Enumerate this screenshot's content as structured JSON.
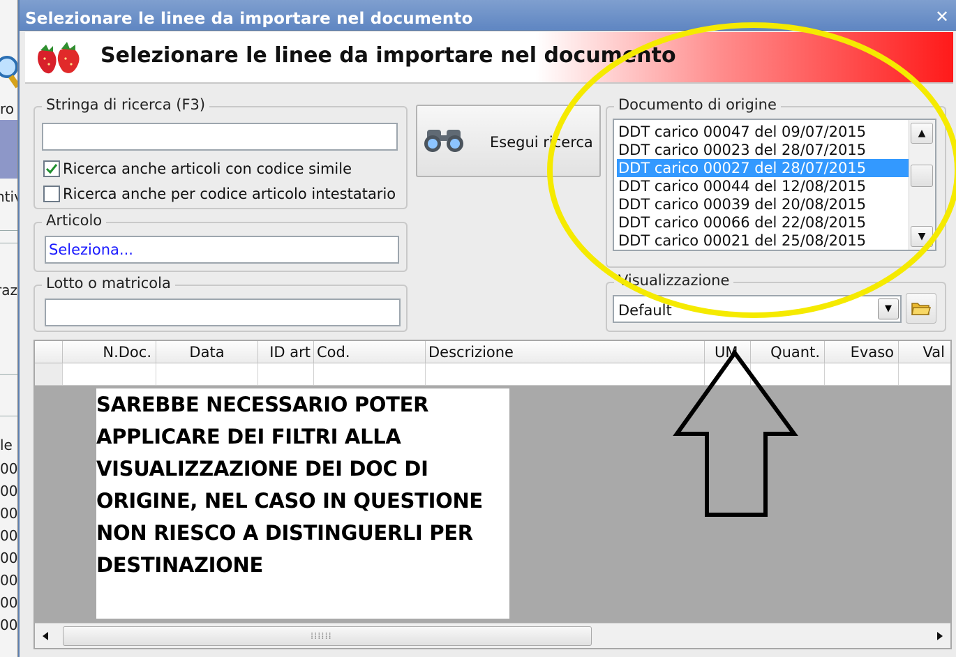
{
  "window": {
    "title": "Selezionare le linee da importare nel documento",
    "close_glyph": "✕"
  },
  "header": {
    "title": "Selezionare le linee da importare nel documento",
    "icon": "strawberry-logo-icon"
  },
  "background_app": {
    "fragments": [
      "ro",
      "ntiv",
      "raz",
      "le",
      "00",
      "00",
      "00",
      "00",
      "00",
      "00",
      "00",
      "00"
    ]
  },
  "search": {
    "group_label": "Stringa di ricerca (F3)",
    "value": "",
    "checkbox1": {
      "label": "Ricerca anche articoli con codice simile",
      "checked": true
    },
    "checkbox2": {
      "label": "Ricerca anche per codice articolo intestatario",
      "checked": false
    }
  },
  "articolo": {
    "group_label": "Articolo",
    "value": "Seleziona..."
  },
  "lotto": {
    "group_label": "Lotto o matricola",
    "value": ""
  },
  "search_button": {
    "label": "Esegui ricerca",
    "icon": "binoculars-icon"
  },
  "documento_origine": {
    "group_label": "Documento di origine",
    "items": [
      "DDT carico 00047 del 09/07/2015",
      "DDT carico 00023 del 28/07/2015",
      "DDT carico 00027 del 28/07/2015",
      "DDT carico 00044 del 12/08/2015",
      "DDT carico 00039 del 20/08/2015",
      "DDT carico 00066 del 22/08/2015",
      "DDT carico 00021 del 25/08/2015"
    ],
    "selected_index": 2
  },
  "visualizzazione": {
    "group_label": "Visualizzazione",
    "value": "Default",
    "folder_icon": "folder-icon"
  },
  "grid": {
    "columns": [
      "",
      "N.Doc.",
      "Data",
      "ID art",
      "Cod.",
      "Descrizione",
      "UM",
      "Quant.",
      "Evaso",
      "Val"
    ]
  },
  "annotation": {
    "lines": [
      "SAREBBE NECESSARIO POTER",
      "APPLICARE DEI FILTRI ALLA",
      "VISUALIZZAZIONE DEI DOC DI",
      "ORIGINE, NEL CASO IN QUESTIONE",
      "NON RIESCO A DISTINGUERLI PER",
      "DESTINAZIONE"
    ],
    "highlight_color": "#f5ea00",
    "arrow_color": "#000000"
  },
  "colors": {
    "titlebar": "#6b8fc7",
    "selection": "#3399ff",
    "header_gradient_end": "#ff1a1a"
  }
}
